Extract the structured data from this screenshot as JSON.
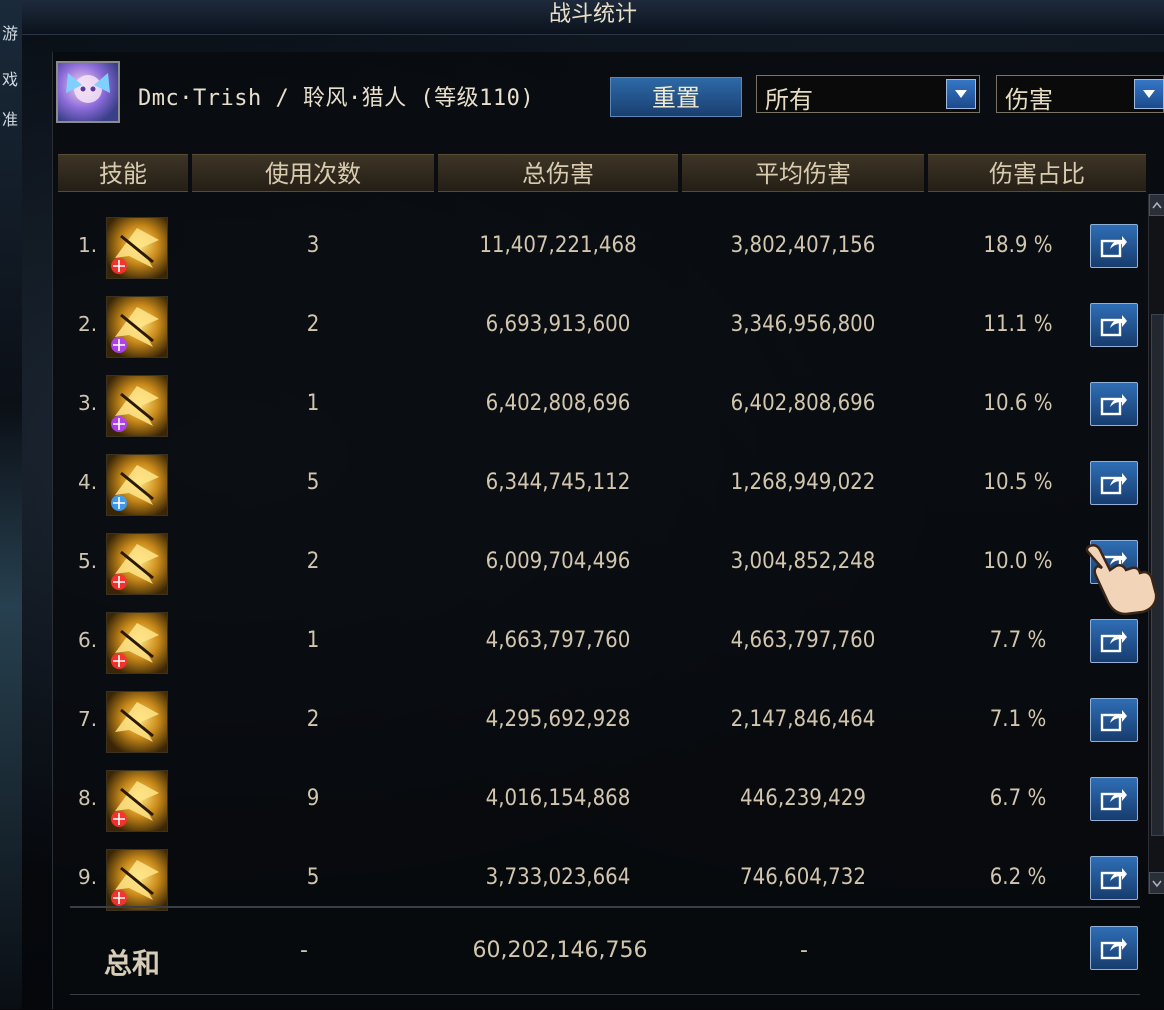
{
  "window": {
    "title": "战斗统计"
  },
  "left_strip_chars": [
    "游",
    "戏",
    "准"
  ],
  "character": {
    "name": "Dmc·Trish / 聆风·猎人 (等级110)"
  },
  "controls": {
    "reset_label": "重置",
    "filter_select": "所有",
    "metric_select": "伤害"
  },
  "table": {
    "headers": [
      "技能",
      "使用次数",
      "总伤害",
      "平均伤害",
      "伤害占比"
    ],
    "rows": [
      {
        "rank": "1.",
        "uses": "3",
        "total": "11,407,221,468",
        "avg": "3,802,407,156",
        "share": "18.9 %"
      },
      {
        "rank": "2.",
        "uses": "2",
        "total": "6,693,913,600",
        "avg": "3,346,956,800",
        "share": "11.1 %"
      },
      {
        "rank": "3.",
        "uses": "1",
        "total": "6,402,808,696",
        "avg": "6,402,808,696",
        "share": "10.6 %"
      },
      {
        "rank": "4.",
        "uses": "5",
        "total": "6,344,745,112",
        "avg": "1,268,949,022",
        "share": "10.5 %"
      },
      {
        "rank": "5.",
        "uses": "2",
        "total": "6,009,704,496",
        "avg": "3,004,852,248",
        "share": "10.0 %"
      },
      {
        "rank": "6.",
        "uses": "1",
        "total": "4,663,797,760",
        "avg": "4,663,797,760",
        "share": "7.7 %"
      },
      {
        "rank": "7.",
        "uses": "2",
        "total": "4,295,692,928",
        "avg": "2,147,846,464",
        "share": "7.1 %"
      },
      {
        "rank": "8.",
        "uses": "9",
        "total": "4,016,154,868",
        "avg": "446,239,429",
        "share": "6.7 %"
      },
      {
        "rank": "9.",
        "uses": "5",
        "total": "3,733,023,664",
        "avg": "746,604,732",
        "share": "6.2 %"
      }
    ],
    "total": {
      "label": "总和",
      "uses": "-",
      "total": "60,202,146,756",
      "avg": "-"
    }
  },
  "icons": {
    "share": "share-export-icon",
    "dropdown": "chevron-down-icon"
  },
  "colors": {
    "accent_blue": "#2f6eb5",
    "header_bg": "#3d3526",
    "text": "#d2c6ae"
  }
}
